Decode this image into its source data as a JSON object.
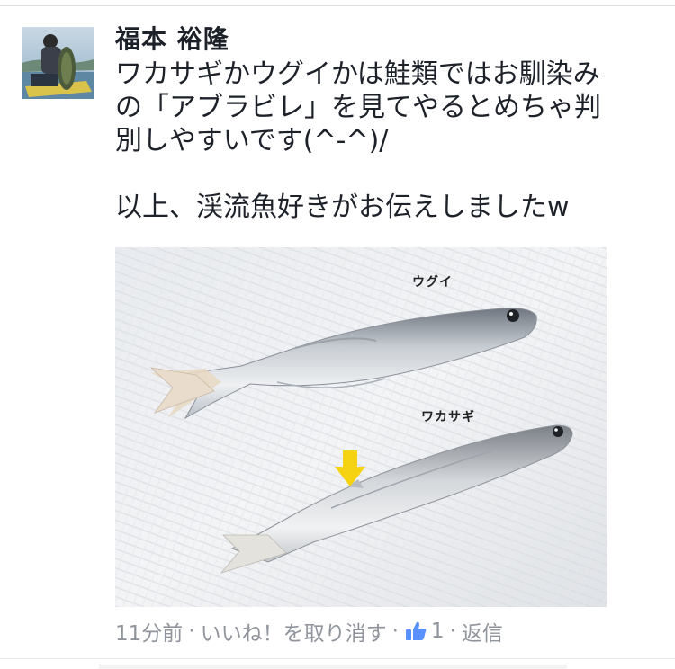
{
  "comment": {
    "author": "福本 裕隆",
    "text_lines": [
      "ワカサギかウグイかは鮭類ではお馴染み",
      "の「アブラビレ」を見てやるとめちゃ判",
      "別しやすいです(^-^)/",
      "",
      "以上、渓流魚好きがお伝えしましたw"
    ],
    "photo": {
      "label_top_fish": "ウグイ",
      "label_bottom_fish": "ワカサギ"
    },
    "meta": {
      "time": "11分前",
      "unlike_label": "いいね！を取り消す",
      "like_count": "1",
      "reply_label": "返信",
      "separator": "·"
    }
  },
  "colors": {
    "text": "#1d2129",
    "meta": "#90949c",
    "like_blue": "#5890ff",
    "arrow_yellow": "#f5d312"
  },
  "icons": [
    "thumbs-up-icon",
    "down-arrow-icon"
  ]
}
